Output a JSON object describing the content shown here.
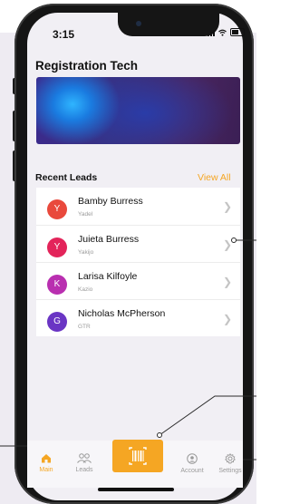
{
  "status": {
    "time": "3:15"
  },
  "app": {
    "title": "Registration Tech"
  },
  "leads": {
    "heading": "Recent Leads",
    "view_all": "View All",
    "items": [
      {
        "initial": "Y",
        "name": "Bamby Burress",
        "company": "Yadel",
        "color": "#e9493c"
      },
      {
        "initial": "Y",
        "name": "Juieta Burress",
        "company": "Yakijo",
        "color": "#e3245a"
      },
      {
        "initial": "K",
        "name": "Larisa Kilfoyle",
        "company": "Kazio",
        "color": "#b92fb0"
      },
      {
        "initial": "G",
        "name": "Nicholas McPherson",
        "company": "GTR",
        "color": "#6a35c4"
      }
    ]
  },
  "tabs": {
    "main": "Main",
    "leads": "Leads",
    "account": "Account",
    "settings": "Settings"
  },
  "colors": {
    "accent": "#f5a623",
    "background": "#f1eff4"
  }
}
